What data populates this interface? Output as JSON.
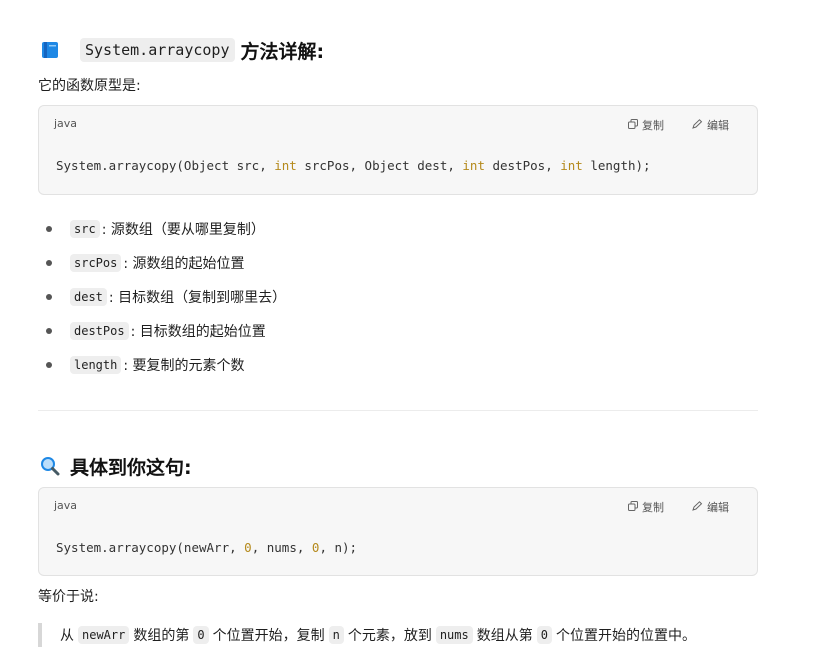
{
  "section1": {
    "code_title": "System.arraycopy",
    "title_suffix": "方法详解:",
    "intro": "它的函数原型是:",
    "code_block": {
      "lang": "java",
      "copy_label": "复制",
      "edit_label": "编辑",
      "code_prefix": "System.arraycopy(Object src, ",
      "kw1": "int",
      "code_mid1": " srcPos, Object dest, ",
      "kw2": "int",
      "code_mid2": " destPos, ",
      "kw3": "int",
      "code_suffix": " length);"
    },
    "params": [
      {
        "name": "src",
        "desc": ": 源数组（要从哪里复制）"
      },
      {
        "name": "srcPos",
        "desc": ": 源数组的起始位置"
      },
      {
        "name": "dest",
        "desc": ": 目标数组（复制到哪里去）"
      },
      {
        "name": "destPos",
        "desc": ": 目标数组的起始位置"
      },
      {
        "name": "length",
        "desc": ": 要复制的元素个数"
      }
    ]
  },
  "section2": {
    "title": "具体到你这句:",
    "code_block": {
      "lang": "java",
      "copy_label": "复制",
      "edit_label": "编辑",
      "code_prefix": "System.arraycopy(newArr, ",
      "n1": "0",
      "code_mid": ", nums, ",
      "n2": "0",
      "code_suffix": ", n);"
    },
    "equivalent": "等价于说:",
    "quote": {
      "t1": "从",
      "c1": "newArr",
      "t2": "数组的第",
      "c2": "0",
      "t3": "个位置开始，复制",
      "c3": "n",
      "t4": "个元素，放到",
      "c4": "nums",
      "t5": "数组从第",
      "c5": "0",
      "t6": "个位置开始的位置中。"
    }
  },
  "icons": {
    "section1": "book-icon",
    "section2": "magnifier-icon",
    "copy": "copy-icon",
    "edit": "edit-icon"
  },
  "colors": {
    "keyword": "#b58a1c",
    "code_bg": "#f7f7f7",
    "book_blue": "#1e88e5"
  }
}
